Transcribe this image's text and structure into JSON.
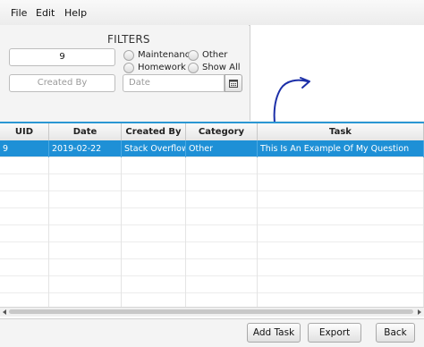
{
  "menubar": {
    "items": [
      "File",
      "Edit",
      "Help"
    ]
  },
  "filters": {
    "title": "FILTERS",
    "uid_value": "9",
    "created_by_placeholder": "Created By",
    "date_placeholder": "Date",
    "radios": [
      "Maintenance",
      "Other",
      "Homework",
      "Show All"
    ],
    "calendar_icon": "calendar-icon"
  },
  "table": {
    "columns": [
      "UID",
      "Date",
      "Created By",
      "Category",
      "Task"
    ],
    "rows": [
      {
        "uid": "9",
        "date": "2019-02-22",
        "created_by": "Stack Overflow",
        "category": "Other",
        "task": "This Is An Example Of My Question"
      }
    ],
    "selected_color": "#1e90d6",
    "header_accent": "#2b97d3"
  },
  "footer": {
    "add_task": "Add Task",
    "export": "Export",
    "back": "Back"
  },
  "annotation": {
    "color": "#1c2fa8",
    "shape": "curved-arrow"
  }
}
